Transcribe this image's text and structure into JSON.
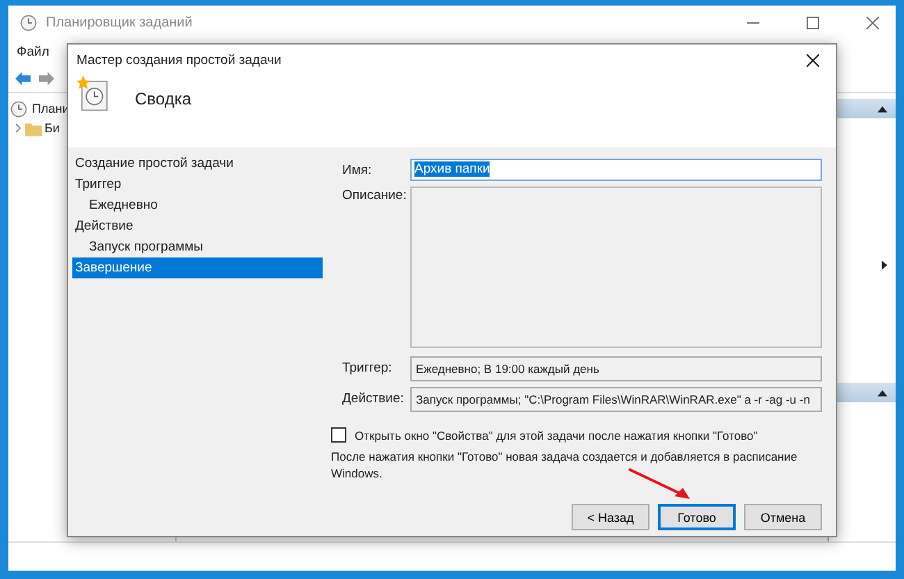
{
  "window": {
    "title": "Планировщик заданий"
  },
  "menu": [
    "Файл"
  ],
  "tree": [
    {
      "label": "Плани",
      "children": [
        {
          "label": "Би",
          "expanded": false
        }
      ]
    }
  ],
  "actions_pane": {
    "sections": [
      {
        "expanded": true
      },
      {
        "expanded": true
      }
    ]
  },
  "dialog": {
    "title": "Мастер создания простой задачи",
    "heading": "Сводка",
    "steps": [
      {
        "label": "Создание простой задачи",
        "selected": false
      },
      {
        "label": "Триггер",
        "selected": false,
        "children": [
          {
            "label": "Ежедневно",
            "selected": false
          }
        ]
      },
      {
        "label": "Действие",
        "selected": false,
        "children": [
          {
            "label": "Запуск программы",
            "selected": false
          }
        ]
      },
      {
        "label": "Завершение",
        "selected": true
      }
    ],
    "fields": [
      {
        "kind": "text",
        "label": "Имя:",
        "value": "Архив папки",
        "highlighted": true
      },
      {
        "kind": "area",
        "label": "Описание:"
      },
      {
        "kind": "readonly",
        "label": "Триггер:",
        "value": "Ежедневно; В 19:00 каждый день"
      },
      {
        "kind": "readonly",
        "label": "Действие:",
        "value": "Запуск программы; \"C:\\Program Files\\WinRAR\\WinRAR.exe\" a -r -ag -u -n"
      }
    ],
    "open_properties": {
      "label": "Открыть окно \"Свойства\" для этой задачи после нажатия кнопки \"Готово\"",
      "checked": false
    },
    "note": "После нажатия кнопки \"Готово\" новая задача создается и добавляется в расписание Windows.",
    "buttons": [
      {
        "label": "< Назад",
        "default": false
      },
      {
        "label": "Готово",
        "default": true
      },
      {
        "label": "Отмена",
        "default": false
      }
    ]
  }
}
